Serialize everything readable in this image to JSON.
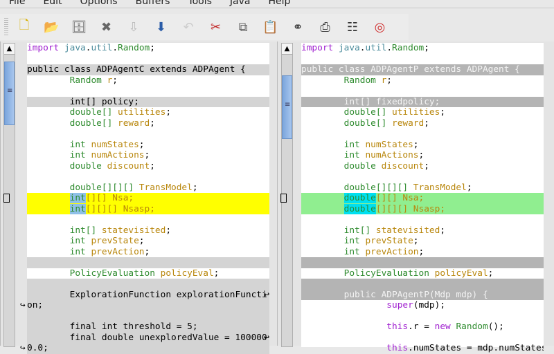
{
  "menu": [
    "File",
    "Edit",
    "Options",
    "Buffers",
    "Tools",
    "Java",
    "Help"
  ],
  "toolbar": [
    {
      "name": "new-file-icon",
      "glyph": "🗋",
      "color": "#d8b000"
    },
    {
      "name": "open-folder-icon",
      "glyph": "📂",
      "color": "#e08a30"
    },
    {
      "name": "save-icon",
      "glyph": "🗄",
      "color": "#666"
    },
    {
      "name": "close-icon",
      "glyph": "✖",
      "color": "#666"
    },
    {
      "name": "download-disabled-icon",
      "glyph": "⇩",
      "color": "#bbb"
    },
    {
      "name": "save-as-icon",
      "glyph": "⬇",
      "color": "#2a5ca8"
    },
    {
      "name": "undo-disabled-icon",
      "glyph": "↶",
      "color": "#ccc"
    },
    {
      "name": "cut-icon",
      "glyph": "✂",
      "color": "#c02020"
    },
    {
      "name": "copy-icon",
      "glyph": "⧉",
      "color": "#666"
    },
    {
      "name": "paste-icon",
      "glyph": "📋",
      "color": "#b08020"
    },
    {
      "name": "find-binoculars-icon",
      "glyph": "⚭",
      "color": "#333"
    },
    {
      "name": "print-icon",
      "glyph": "⎙",
      "color": "#444"
    },
    {
      "name": "preferences-icon",
      "glyph": "☷",
      "color": "#333"
    },
    {
      "name": "help-icon",
      "glyph": "◎",
      "color": "#d03030"
    }
  ],
  "colors": {
    "yellow": "#ffff00",
    "green": "#90ee90",
    "gray_left": "#d4d4d4",
    "gray_right": "#b4b4b4"
  },
  "left": {
    "lines": [
      {
        "tk": [
          [
            "import ",
            "k"
          ],
          [
            "java",
            "pk"
          ],
          [
            ".",
            "p"
          ],
          [
            "util",
            "pk"
          ],
          [
            ".",
            "p"
          ],
          [
            "Random",
            "t"
          ],
          [
            ";",
            "p"
          ]
        ]
      },
      {
        "tk": []
      },
      {
        "bg": "gray",
        "tk": [
          [
            "public class ADPAgentC extends ADPAgent {",
            "p"
          ]
        ]
      },
      {
        "tk": [
          [
            "        Random ",
            "t"
          ],
          [
            "r",
            "v"
          ],
          [
            ";",
            "p"
          ]
        ]
      },
      {
        "tk": []
      },
      {
        "bg": "gray",
        "tk": [
          [
            "        int[] policy;",
            "p"
          ]
        ]
      },
      {
        "tk": [
          [
            "        double[] ",
            "t"
          ],
          [
            "utilities",
            "v"
          ],
          [
            ";",
            "p"
          ]
        ]
      },
      {
        "tk": [
          [
            "        double[] ",
            "t"
          ],
          [
            "reward",
            "v"
          ],
          [
            ";",
            "p"
          ]
        ]
      },
      {
        "tk": []
      },
      {
        "tk": [
          [
            "        int ",
            "t"
          ],
          [
            "numStates",
            "v"
          ],
          [
            ";",
            "p"
          ]
        ]
      },
      {
        "tk": [
          [
            "        int ",
            "t"
          ],
          [
            "numActions",
            "v"
          ],
          [
            ";",
            "p"
          ]
        ]
      },
      {
        "tk": [
          [
            "        double ",
            "t"
          ],
          [
            "discount",
            "v"
          ],
          [
            ";",
            "p"
          ]
        ]
      },
      {
        "tk": []
      },
      {
        "tk": [
          [
            "        double[][][] ",
            "t"
          ],
          [
            "TransModel",
            "v"
          ],
          [
            ";",
            "p"
          ]
        ]
      },
      {
        "bg": "yellow",
        "mark": true,
        "tk": [
          [
            "        ",
            "p"
          ],
          [
            "int",
            "t lb"
          ],
          [
            "[][] Nsa;",
            "br"
          ]
        ]
      },
      {
        "bg": "yellow",
        "tk": [
          [
            "        ",
            "p"
          ],
          [
            "int",
            "t lb"
          ],
          [
            "[][][] Nsasp;",
            "br"
          ]
        ]
      },
      {
        "tk": []
      },
      {
        "tk": [
          [
            "        int[] ",
            "t"
          ],
          [
            "statevisited",
            "v"
          ],
          [
            ";",
            "p"
          ]
        ]
      },
      {
        "tk": [
          [
            "        int ",
            "t"
          ],
          [
            "prevState",
            "v"
          ],
          [
            ";",
            "p"
          ]
        ]
      },
      {
        "tk": [
          [
            "        int ",
            "t"
          ],
          [
            "prevAction",
            "v"
          ],
          [
            ";",
            "p"
          ]
        ]
      },
      {
        "bg": "gray",
        "tk": []
      },
      {
        "tk": [
          [
            "        PolicyEvaluation ",
            "t"
          ],
          [
            "policyEval",
            "v"
          ],
          [
            ";",
            "p"
          ]
        ]
      },
      {
        "bg": "gray",
        "tk": []
      },
      {
        "bg": "gray",
        "wrap": "end",
        "tk": [
          [
            "        ExplorationFunction explorationFuncti",
            "p"
          ]
        ]
      },
      {
        "bg": "gray",
        "wrap": "start",
        "tk": [
          [
            "on;",
            "p"
          ]
        ]
      },
      {
        "bg": "gray",
        "tk": []
      },
      {
        "bg": "gray",
        "tk": [
          [
            "        final int threshold = 5;",
            "p"
          ]
        ]
      },
      {
        "bg": "gray",
        "wrap": "end",
        "tk": [
          [
            "        final double unexploredValue = 100000",
            "p"
          ]
        ]
      },
      {
        "bg": "gray",
        "wrap": "start",
        "tk": [
          [
            "0.0;",
            "p"
          ]
        ]
      }
    ]
  },
  "right": {
    "lines": [
      {
        "tk": [
          [
            "import ",
            "k"
          ],
          [
            "java",
            "pk"
          ],
          [
            ".",
            "p"
          ],
          [
            "util",
            "pk"
          ],
          [
            ".",
            "p"
          ],
          [
            "Random",
            "t"
          ],
          [
            ";",
            "p"
          ]
        ]
      },
      {
        "tk": []
      },
      {
        "bg": "gray",
        "tk": [
          [
            "public class ADPAgentP extends ADPAgent {",
            "tx"
          ]
        ]
      },
      {
        "tk": [
          [
            "        Random ",
            "t"
          ],
          [
            "r",
            "v"
          ],
          [
            ";",
            "p"
          ]
        ]
      },
      {
        "tk": []
      },
      {
        "bg": "gray",
        "tk": [
          [
            "        int[] fixedpolicy;",
            "tx"
          ]
        ]
      },
      {
        "tk": [
          [
            "        double[] ",
            "t"
          ],
          [
            "utilities",
            "v"
          ],
          [
            ";",
            "p"
          ]
        ]
      },
      {
        "tk": [
          [
            "        double[] ",
            "t"
          ],
          [
            "reward",
            "v"
          ],
          [
            ";",
            "p"
          ]
        ]
      },
      {
        "tk": []
      },
      {
        "tk": [
          [
            "        int ",
            "t"
          ],
          [
            "numStates",
            "v"
          ],
          [
            ";",
            "p"
          ]
        ]
      },
      {
        "tk": [
          [
            "        int ",
            "t"
          ],
          [
            "numActions",
            "v"
          ],
          [
            ";",
            "p"
          ]
        ]
      },
      {
        "tk": [
          [
            "        double ",
            "t"
          ],
          [
            "discount",
            "v"
          ],
          [
            ";",
            "p"
          ]
        ]
      },
      {
        "tk": []
      },
      {
        "tk": [
          [
            "        double[][][] ",
            "t"
          ],
          [
            "TransModel",
            "v"
          ],
          [
            ";",
            "p"
          ]
        ]
      },
      {
        "bg": "green",
        "mark": true,
        "tk": [
          [
            "        ",
            "p"
          ],
          [
            "double",
            "t cyan"
          ],
          [
            "[][] Nsa;",
            "br"
          ]
        ]
      },
      {
        "bg": "green",
        "tk": [
          [
            "        ",
            "p"
          ],
          [
            "double",
            "t cyan"
          ],
          [
            "[][][] Nsasp;",
            "br"
          ]
        ]
      },
      {
        "tk": []
      },
      {
        "tk": [
          [
            "        int[] ",
            "t"
          ],
          [
            "statevisited",
            "v"
          ],
          [
            ";",
            "p"
          ]
        ]
      },
      {
        "tk": [
          [
            "        int ",
            "t"
          ],
          [
            "prevState",
            "v"
          ],
          [
            ";",
            "p"
          ]
        ]
      },
      {
        "tk": [
          [
            "        int ",
            "t"
          ],
          [
            "prevAction",
            "v"
          ],
          [
            ";",
            "p"
          ]
        ]
      },
      {
        "bg": "gray",
        "tk": []
      },
      {
        "tk": [
          [
            "        PolicyEvaluation ",
            "t"
          ],
          [
            "policyEval",
            "v"
          ],
          [
            ";",
            "p"
          ]
        ]
      },
      {
        "bg": "gray",
        "tk": []
      },
      {
        "bg": "gray",
        "tk": [
          [
            "        public ADPAgentP(Mdp mdp) {",
            "tx"
          ]
        ]
      },
      {
        "tk": [
          [
            "                ",
            "p"
          ],
          [
            "super",
            "k"
          ],
          [
            "(mdp);",
            "p"
          ]
        ]
      },
      {
        "tk": []
      },
      {
        "tk": [
          [
            "                ",
            "p"
          ],
          [
            "this",
            "k"
          ],
          [
            ".r = ",
            "p"
          ],
          [
            "new ",
            "k"
          ],
          [
            "Random",
            "t"
          ],
          [
            "();",
            "p"
          ]
        ]
      },
      {
        "tk": []
      },
      {
        "tk": [
          [
            "                ",
            "p"
          ],
          [
            "this",
            "k"
          ],
          [
            ".numStates = mdp.numStates;",
            "p"
          ]
        ]
      }
    ]
  }
}
